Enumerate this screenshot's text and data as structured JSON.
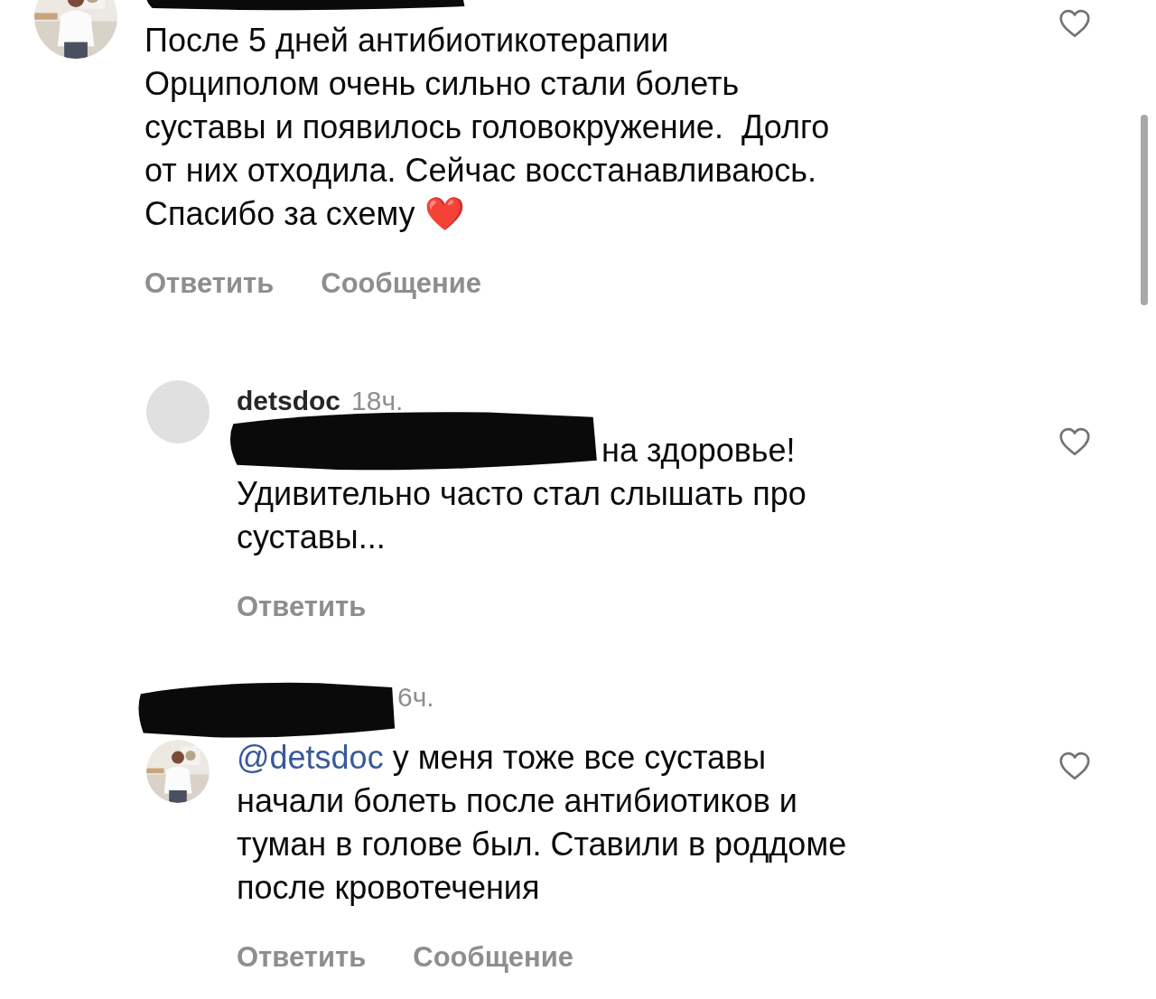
{
  "comments": [
    {
      "kind": "comment",
      "avatar": {
        "kind": "picture"
      },
      "liked": false,
      "lines": [
        "После 5 дней антибиотикотерапии",
        "Орциполом очень сильно стали болеть",
        "суставы и появилось головокружение.  Долго",
        "от них отходила. Сейчас восстанавливаюсь.",
        "Спасибо за схему ❤️"
      ],
      "actions": [
        "Ответить",
        "Сообщение"
      ]
    },
    {
      "kind": "reply",
      "avatar": {
        "kind": "placeholder"
      },
      "username": "detsdoc",
      "time": "18ч.",
      "mention_hidden": true,
      "liked": false,
      "lines": [
        "на здоровье!",
        "Удивительно часто стал слышать про",
        "суставы..."
      ],
      "actions": [
        "Ответить"
      ]
    },
    {
      "kind": "reply",
      "avatar": {
        "kind": "picture"
      },
      "time": "6ч.",
      "username_hidden": true,
      "mention": "@detsdoc",
      "liked": false,
      "lines": [
        "у меня тоже все суставы",
        "начали болеть после антибиотиков и",
        "туман в голове был. Ставили в роддоме",
        "после кровотечения"
      ],
      "actions": [
        "Ответить",
        "Сообщение"
      ]
    }
  ]
}
